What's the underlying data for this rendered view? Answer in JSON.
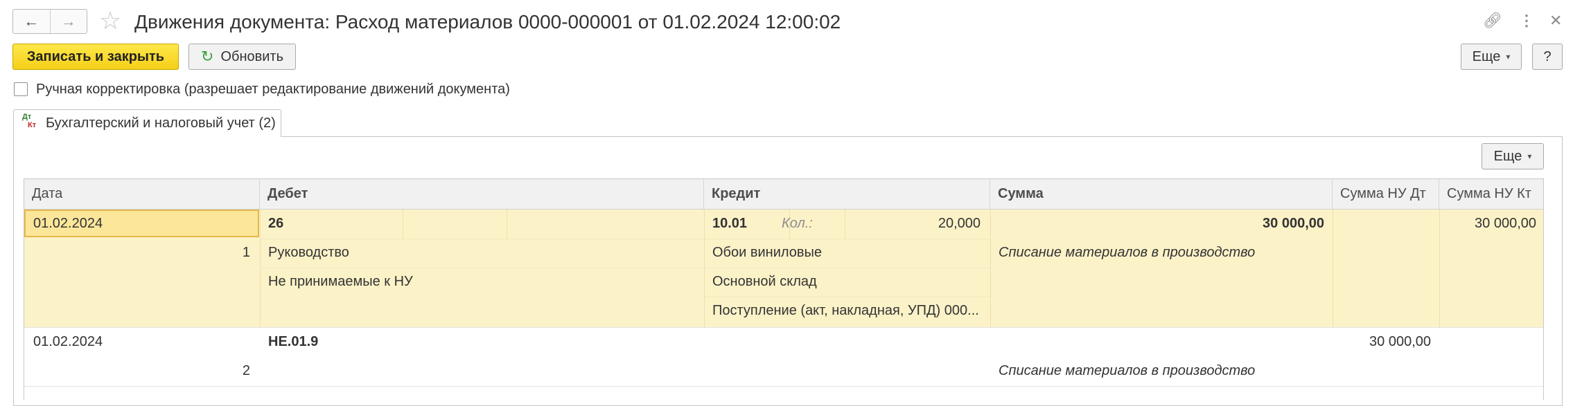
{
  "window": {
    "title": "Движения документа: Расход материалов 0000-000001 от 01.02.2024 12:00:02",
    "nav": {
      "back": "←",
      "forward": "→"
    },
    "icons": {
      "star": "star-icon",
      "link": "link-icon",
      "more": "more-icon",
      "close": "close-icon"
    }
  },
  "toolbar": {
    "save_close_label": "Записать и закрыть",
    "refresh_label": "Обновить",
    "more_label": "Еще",
    "help_label": "?"
  },
  "manual_correction": {
    "checked": false,
    "label": "Ручная корректировка (разрешает редактирование движений документа)"
  },
  "tab": {
    "icon_dt": "Дт",
    "icon_kt": "Кт",
    "label": "Бухгалтерский и налоговый учет (2)"
  },
  "table_toolbar": {
    "more_label": "Еще"
  },
  "table": {
    "columns": {
      "date": "Дата",
      "debit": "Дебет",
      "credit": "Кредит",
      "sum": "Сумма",
      "sum_nu_dt": "Сумма НУ Дт",
      "sum_nu_kt": "Сумма НУ Кт"
    },
    "rows": [
      {
        "date": "01.02.2024",
        "number": "1",
        "debit_account": "26",
        "debit_sub1": "Руководство",
        "debit_sub2": "Не принимаемые к НУ",
        "credit_account": "10.01",
        "qty_label": "Кол.:",
        "qty_value": "20,000",
        "credit_sub1": "Обои виниловые",
        "credit_sub2": "Основной склад",
        "credit_sub3": "Поступление (акт, накладная, УПД) 000...",
        "sum": "30 000,00",
        "content": "Списание материалов в производство",
        "sum_nu_dt": "",
        "sum_nu_kt": "30 000,00"
      },
      {
        "date": "01.02.2024",
        "number": "2",
        "debit_account": "НЕ.01.9",
        "sum_nu_dt": "30 000,00",
        "content": "Списание материалов в производство"
      }
    ]
  },
  "colors": {
    "accent": "#fbe036",
    "selected_row": "#fcf2c8",
    "selected_cell": "#fbe69a"
  }
}
